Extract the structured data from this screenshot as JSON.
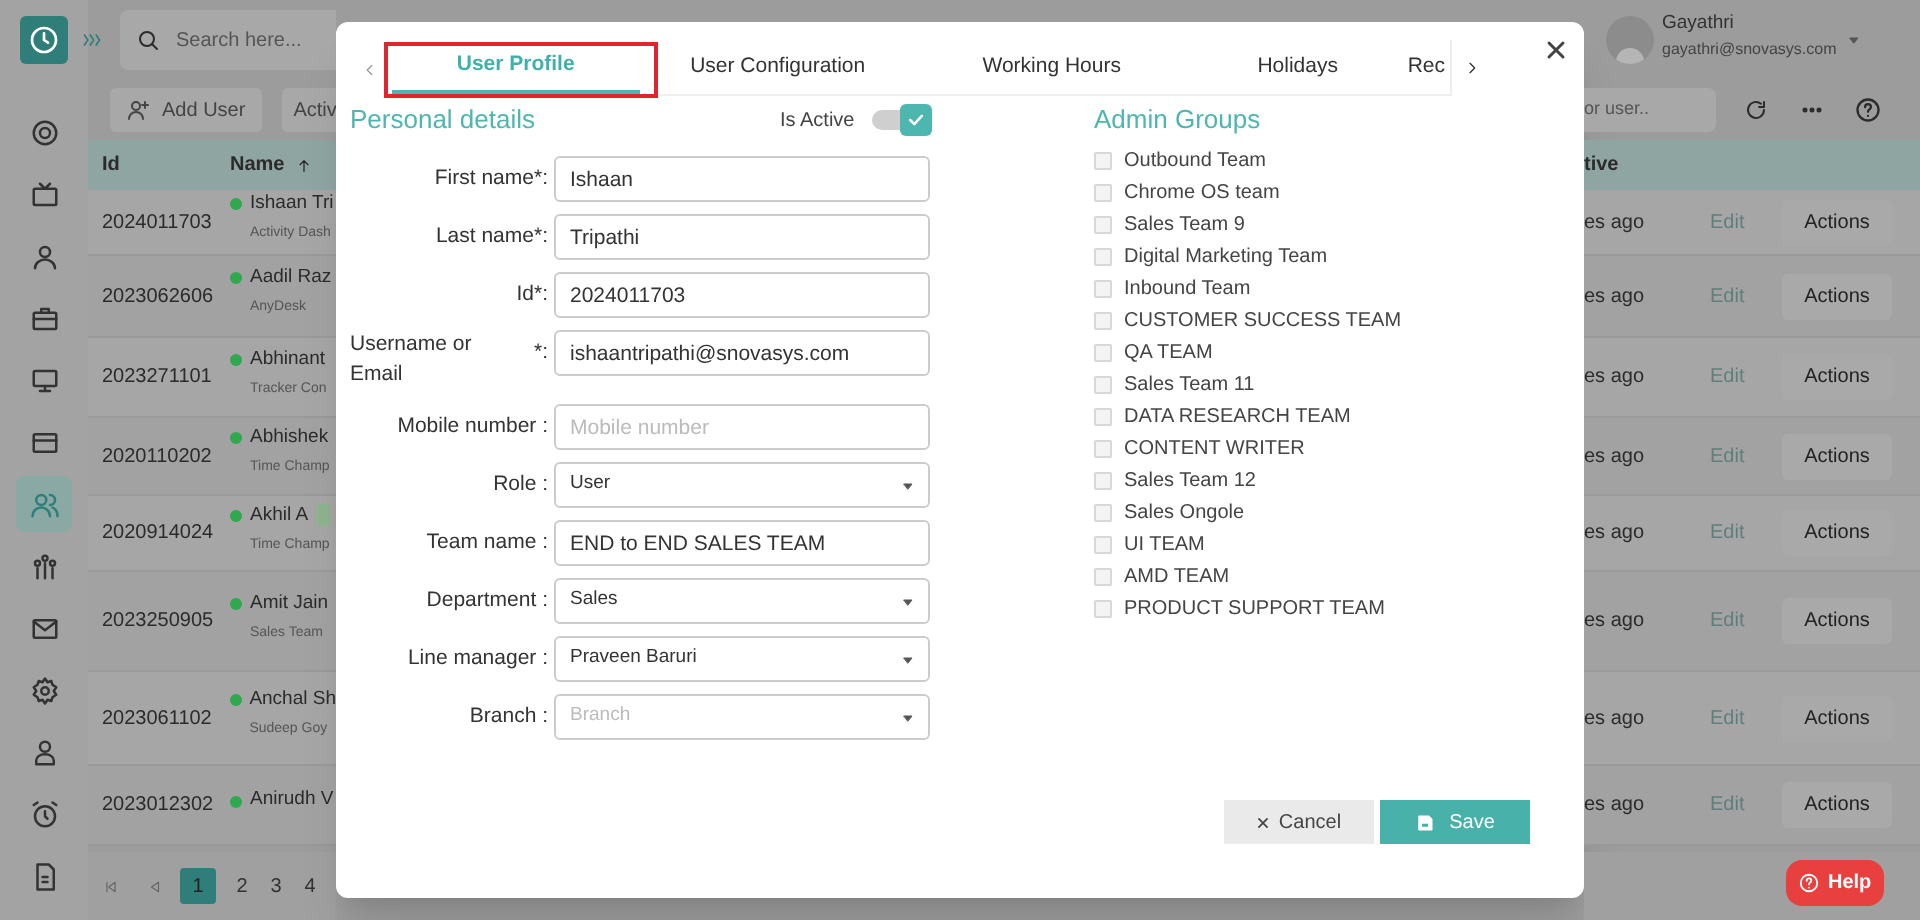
{
  "sidebar": {
    "items": [
      {
        "selected": false
      },
      {
        "selected": false
      },
      {
        "selected": false
      },
      {
        "selected": false
      },
      {
        "selected": false
      },
      {
        "selected": false
      },
      {
        "selected": true
      },
      {
        "selected": false
      },
      {
        "selected": false
      },
      {
        "selected": false
      },
      {
        "selected": false
      },
      {
        "selected": false
      },
      {
        "selected": false
      }
    ]
  },
  "top_bar": {
    "search_placeholder": "Search here...",
    "user_name": "Gayathri",
    "user_email": "gayathri@snovasys.com"
  },
  "toolbar": {
    "add_user": "Add User",
    "status_filter": "Activ",
    "user_search_placeholder": "or user.."
  },
  "table": {
    "columns": [
      "Id",
      "Name",
      "tive"
    ],
    "rows": [
      {
        "id": "2024011703",
        "name": "Ishaan Tri",
        "subtitle": "Activity Dash",
        "tag": false,
        "time": "es ago",
        "edit": "Edit",
        "action": "Actions"
      },
      {
        "id": "2023062606",
        "name": "Aadil Raz",
        "subtitle": "AnyDesk",
        "tag": false,
        "time": "es ago",
        "edit": "Edit",
        "action": "Actions"
      },
      {
        "id": "2023271101",
        "name": "Abhinant",
        "subtitle": "Tracker Con",
        "tag": false,
        "time": "es ago",
        "edit": "Edit",
        "action": "Actions"
      },
      {
        "id": "2020110202",
        "name": "Abhishek",
        "subtitle": "Time Champ",
        "tag": false,
        "time": "es ago",
        "edit": "Edit",
        "action": "Actions"
      },
      {
        "id": "2020914024",
        "name": "Akhil A",
        "subtitle": "Time Champ",
        "tag": true,
        "time": "es ago",
        "edit": "Edit",
        "action": "Actions"
      },
      {
        "id": "2023250905",
        "name": "Amit Jain",
        "subtitle": "Sales Team",
        "tag": false,
        "time": "es ago",
        "edit": "Edit",
        "action": "Actions"
      },
      {
        "id": "2023061102",
        "name": "Anchal Sh",
        "subtitle": "Sudeep Goy",
        "tag": false,
        "time": "es ago",
        "edit": "Edit",
        "action": "Actions"
      },
      {
        "id": "2023012302",
        "name": "Anirudh V",
        "tag": false,
        "time": "es ago",
        "edit": "Edit",
        "action": "Actions"
      }
    ]
  },
  "pagination": {
    "pages": [
      {
        "label": "1",
        "selected": true
      },
      {
        "label": "2",
        "selected": false
      },
      {
        "label": "3",
        "selected": false
      },
      {
        "label": "4",
        "selected": false
      }
    ]
  },
  "dialog": {
    "tabs": [
      {
        "label": "User Profile",
        "selected": true
      },
      {
        "label": "User Configuration",
        "selected": false
      },
      {
        "label": "Working Hours",
        "selected": false
      },
      {
        "label": "Holidays",
        "selected": false
      },
      {
        "label": "Rec",
        "selected": false
      }
    ],
    "personal_details": {
      "title": "Personal details",
      "is_active_label": "Is Active",
      "is_active": true,
      "fields": [
        {
          "kind": "text",
          "label": "First name*:",
          "value": "Ishaan"
        },
        {
          "kind": "text",
          "label": "Last name*:",
          "value": "Tripathi"
        },
        {
          "kind": "text",
          "label": "Id*:",
          "value": "2024011703"
        },
        {
          "kind": "text",
          "label": "Username or Email",
          "label_suffix": "*:",
          "value": "ishaantripathi@snovasys.com"
        },
        {
          "kind": "text",
          "label": "Mobile number :",
          "placeholder": "Mobile number"
        },
        {
          "kind": "select",
          "label": "Role :",
          "value": "User"
        },
        {
          "kind": "text",
          "label": "Team name :",
          "value": "END to END SALES TEAM"
        },
        {
          "kind": "select",
          "label": "Department :",
          "value": "Sales"
        },
        {
          "kind": "select",
          "label": "Line manager :",
          "value": "Praveen Baruri"
        },
        {
          "kind": "select",
          "label": "Branch :",
          "placeholder": "Branch"
        }
      ]
    },
    "admin_groups": {
      "title": "Admin Groups",
      "items": [
        {
          "label": "Outbound Team",
          "checked": false
        },
        {
          "label": "Chrome OS team",
          "checked": false
        },
        {
          "label": "Sales Team 9",
          "checked": false
        },
        {
          "label": "Digital Marketing Team",
          "checked": false
        },
        {
          "label": "Inbound Team",
          "checked": false
        },
        {
          "label": "CUSTOMER SUCCESS TEAM",
          "checked": false
        },
        {
          "label": "QA TEAM",
          "checked": false
        },
        {
          "label": "Sales Team 11",
          "checked": false
        },
        {
          "label": "DATA RESEARCH TEAM",
          "checked": false
        },
        {
          "label": "CONTENT WRITER",
          "checked": false
        },
        {
          "label": "Sales Team 12",
          "checked": false
        },
        {
          "label": "Sales Ongole",
          "checked": false
        },
        {
          "label": "UI TEAM",
          "checked": false
        },
        {
          "label": "AMD TEAM",
          "checked": false
        },
        {
          "label": "PRODUCT SUPPORT TEAM",
          "checked": false
        }
      ]
    },
    "cancel": "Cancel",
    "save": "Save"
  },
  "help": "Help"
}
